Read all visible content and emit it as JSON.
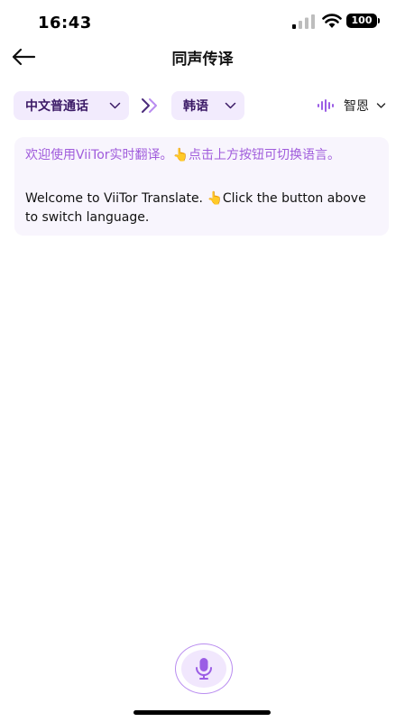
{
  "status_bar": {
    "time": "16:43",
    "battery": "100"
  },
  "header": {
    "title": "同声传译",
    "back_icon": "arrow-left-icon"
  },
  "language_bar": {
    "source_language": "中文普通话",
    "target_language": "韩语",
    "voice": "智恩",
    "swap_icon": "double-chevron-right-icon",
    "voice_icon": "sound-wave-icon"
  },
  "message": {
    "chinese": "欢迎使用ViiTor实时翻译。👆点击上方按钮可切换语言。",
    "english": "Welcome to ViiTor Translate. 👆Click the button above to switch language."
  },
  "mic": {
    "icon": "microphone-icon"
  },
  "colors": {
    "accent": "#9b5de5",
    "pill_bg": "#f2ebfd",
    "card_bg": "#f8f5fd",
    "zh_text": "#a05cdc"
  }
}
